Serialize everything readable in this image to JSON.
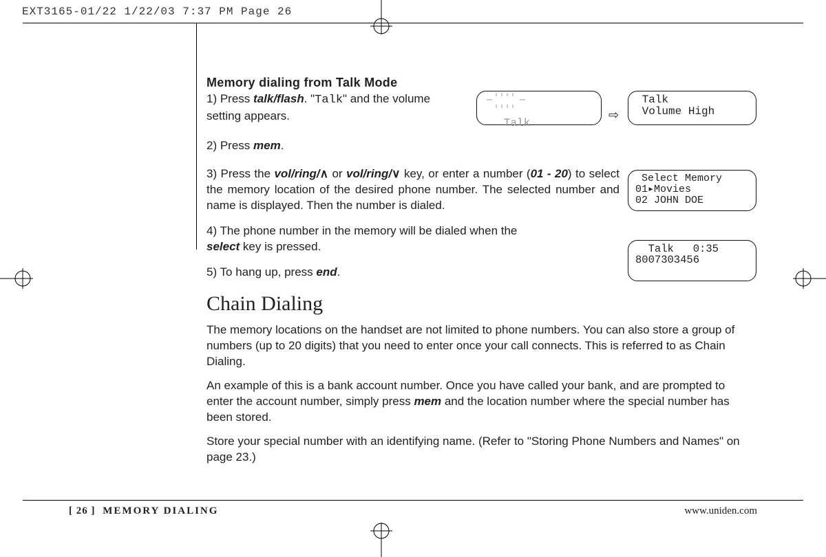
{
  "slug": "EXT3165-01/22  1/22/03  7:37 PM  Page 26",
  "section_title": "Memory dialing from Talk Mode",
  "steps": {
    "s1_pre": "1) Press ",
    "s1_kw": "talk/flash",
    "s1_mid": ". \"",
    "s1_lcd": "Talk",
    "s1_post": "\" and the volume setting appears.",
    "s2_pre": "2) Press ",
    "s2_kw": "mem",
    "s2_post": ".",
    "s3_pre": "3) Press the ",
    "s3_kw1": "vol/ring/",
    "s3_caret_up": "∧",
    "s3_mid1": " or ",
    "s3_kw2": "vol/ring/",
    "s3_caret_dn": "∨",
    "s3_mid2": " key, or enter a number (",
    "s3_range": "01 - 20",
    "s3_post": ") to select the memory location of the desired phone number. The selected number and name is displayed. Then the number is dialed.",
    "s4_pre": "4) The phone number in the memory will be dialed when the ",
    "s4_kw": "select",
    "s4_post": " key is pressed.",
    "s5_pre": "5) To hang up, press ",
    "s5_kw": "end",
    "s5_post": "."
  },
  "chain_heading": "Chain Dialing",
  "chain_p1": "The memory locations on the handset are not limited to phone numbers. You can also store a group of numbers (up to 20 digits) that you need to enter once your call connects. This is referred to as Chain Dialing.",
  "chain_p2a": "An example of this is a bank account number. Once you have called your bank, and are prompted to enter the account number, simply press ",
  "chain_p2_kw": "mem",
  "chain_p2b": " and the location number where the special number has been stored.",
  "chain_p3": "Store your special number with an identifying name. (Refer to \"Storing Phone Numbers and Names\" on page 23.)",
  "lcd1a": " Talk",
  "lcd1b": " Talk\n Volume High",
  "arrow": "⇨",
  "lcd3": " Select Memory\n01▸Movies\n02 JOHN DOE",
  "lcd4": "  Talk   0:35\n8007303456\n ",
  "footer": {
    "page": "[ 26 ]",
    "title": "MEMORY DIALING",
    "url": "www.uniden.com"
  }
}
